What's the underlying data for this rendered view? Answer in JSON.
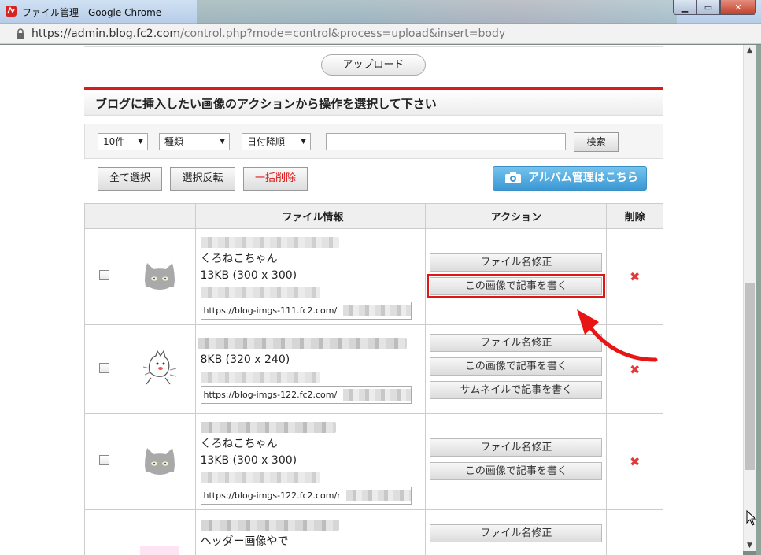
{
  "window": {
    "title": "ファイル管理 - Google Chrome",
    "url_host": "https://admin.blog.fc2.com",
    "url_path": "/control.php?mode=control&process=upload&insert=body"
  },
  "page": {
    "upload_label": "アップロード",
    "section_title": "ブログに挿入したい画像のアクションから操作を選択して下さい",
    "filters": {
      "count": "10件",
      "type": "種類",
      "sort": "日付降順",
      "search_value": "",
      "search_label": "検索"
    },
    "bulk": {
      "select_all": "全て選択",
      "invert": "選択反転",
      "delete_all": "一括削除",
      "album": "アルバム管理はこちら"
    },
    "table": {
      "headers": [
        "",
        "",
        "ファイル情報",
        "アクション",
        "削除"
      ],
      "rows": [
        {
          "name": "くろねこちゃん",
          "size": "13KB (300 x 300)",
          "url": "https://blog-imgs-111.fc2.com/",
          "actions": [
            "ファイル名修正",
            "この画像で記事を書く"
          ],
          "thumb": "cat-gray-icon"
        },
        {
          "name": "",
          "size": "8KB (320 x 240)",
          "url": "https://blog-imgs-122.fc2.com/",
          "actions": [
            "ファイル名修正",
            "この画像で記事を書く",
            "サムネイルで記事を書く"
          ],
          "thumb": "cat-drawing-icon"
        },
        {
          "name": "くろねこちゃん",
          "size": "13KB (300 x 300)",
          "url": "https://blog-imgs-122.fc2.com/r",
          "actions": [
            "ファイル名修正",
            "この画像で記事を書く"
          ],
          "thumb": "cat-gray-icon"
        },
        {
          "name": "ヘッダー画像やで",
          "size": "",
          "url": "",
          "actions": [
            "ファイル名修正"
          ],
          "thumb": "pink-thumb"
        }
      ],
      "delete_glyph": "✖"
    }
  },
  "colors": {
    "accent_red": "#d81b1b",
    "album_blue": "#3b98d3",
    "highlight": "#e01515"
  }
}
